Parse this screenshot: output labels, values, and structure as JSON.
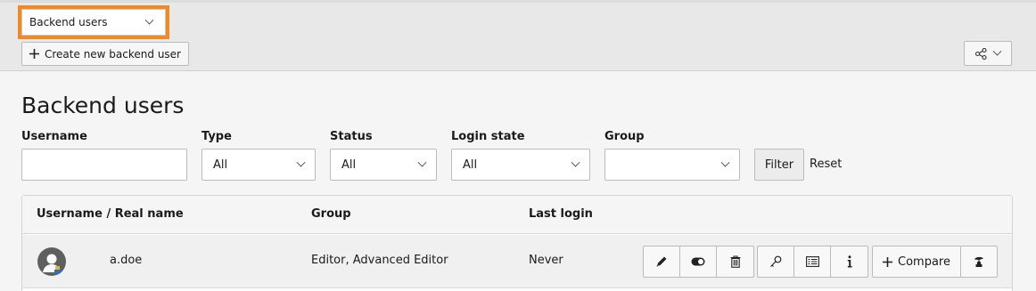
{
  "module_selector": {
    "value": "Backend users"
  },
  "toolbar": {
    "create_label": "Create new backend user"
  },
  "page": {
    "title": "Backend users"
  },
  "filters": {
    "username": {
      "label": "Username",
      "value": ""
    },
    "type": {
      "label": "Type",
      "value": "All"
    },
    "status": {
      "label": "Status",
      "value": "All"
    },
    "login_state": {
      "label": "Login state",
      "value": "All"
    },
    "group": {
      "label": "Group",
      "value": ""
    },
    "filter_button": "Filter",
    "reset_link": "Reset"
  },
  "table": {
    "columns": [
      "Username / Real name",
      "Group",
      "Last login"
    ],
    "rows": [
      {
        "username": "a.doe",
        "group": "Editor, Advanced Editor",
        "last_login": "Never"
      }
    ],
    "compare_label": "Compare"
  },
  "colors": {
    "highlight": "#f08a24",
    "header_bg": "#e8e8e8"
  },
  "icons": [
    "chevron-down-icon",
    "plus-icon",
    "share-icon",
    "edit-icon",
    "toggle-icon",
    "trash-icon",
    "key-icon",
    "info-list-icon",
    "info-icon",
    "switch-user-icon",
    "user-avatar-icon"
  ]
}
